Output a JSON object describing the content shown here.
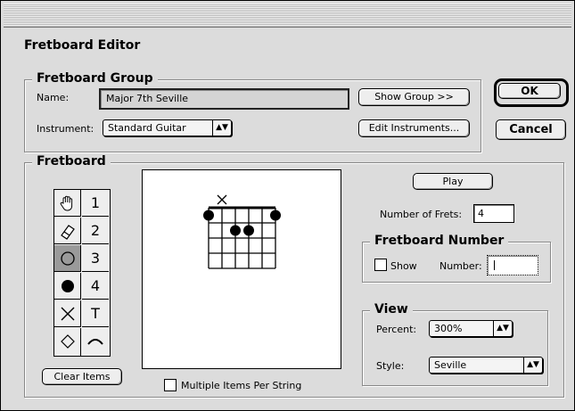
{
  "dialog": {
    "title": "Fretboard Editor"
  },
  "group": {
    "legend": "Fretboard Group",
    "name_label": "Name:",
    "name_value": "Major 7th Seville",
    "show_group_button": "Show Group >>",
    "instrument_label": "Instrument:",
    "instrument_value": "Standard Guitar",
    "edit_instruments_button": "Edit Instruments..."
  },
  "actions": {
    "ok": "OK",
    "cancel": "Cancel"
  },
  "fretboard": {
    "legend": "Fretboard",
    "tools": [
      {
        "name": "hand",
        "icon": "hand-icon"
      },
      {
        "name": "1",
        "label": "1"
      },
      {
        "name": "eraser",
        "icon": "eraser-icon"
      },
      {
        "name": "2",
        "label": "2"
      },
      {
        "name": "open-circle",
        "icon": "open-circle-icon"
      },
      {
        "name": "3",
        "label": "3"
      },
      {
        "name": "filled-circle",
        "icon": "filled-circle-icon"
      },
      {
        "name": "4",
        "label": "4"
      },
      {
        "name": "x",
        "icon": "x-icon"
      },
      {
        "name": "T",
        "label": "T"
      },
      {
        "name": "diamond",
        "icon": "diamond-icon"
      },
      {
        "name": "barre",
        "icon": "barre-arc-icon"
      }
    ],
    "selected_tool": "open-circle",
    "clear_items_button": "Clear Items",
    "multiple_items_label": "Multiple Items Per String",
    "multiple_items_checked": false,
    "play_button": "Play",
    "frets_label": "Number of Frets:",
    "frets_value": "4"
  },
  "fretboard_number": {
    "legend": "Fretboard Number",
    "show_label": "Show",
    "show_checked": false,
    "number_label": "Number:",
    "number_value": ""
  },
  "view": {
    "legend": "View",
    "percent_label": "Percent:",
    "percent_value": "300%",
    "style_label": "Style:",
    "style_value": "Seville"
  },
  "diagram": {
    "strings": 6,
    "frets": 4,
    "muted_strings": [
      2
    ],
    "dots": [
      {
        "string": 1,
        "fret": 1
      },
      {
        "string": 6,
        "fret": 1
      },
      {
        "string": 3,
        "fret": 2
      },
      {
        "string": 4,
        "fret": 2
      }
    ]
  }
}
